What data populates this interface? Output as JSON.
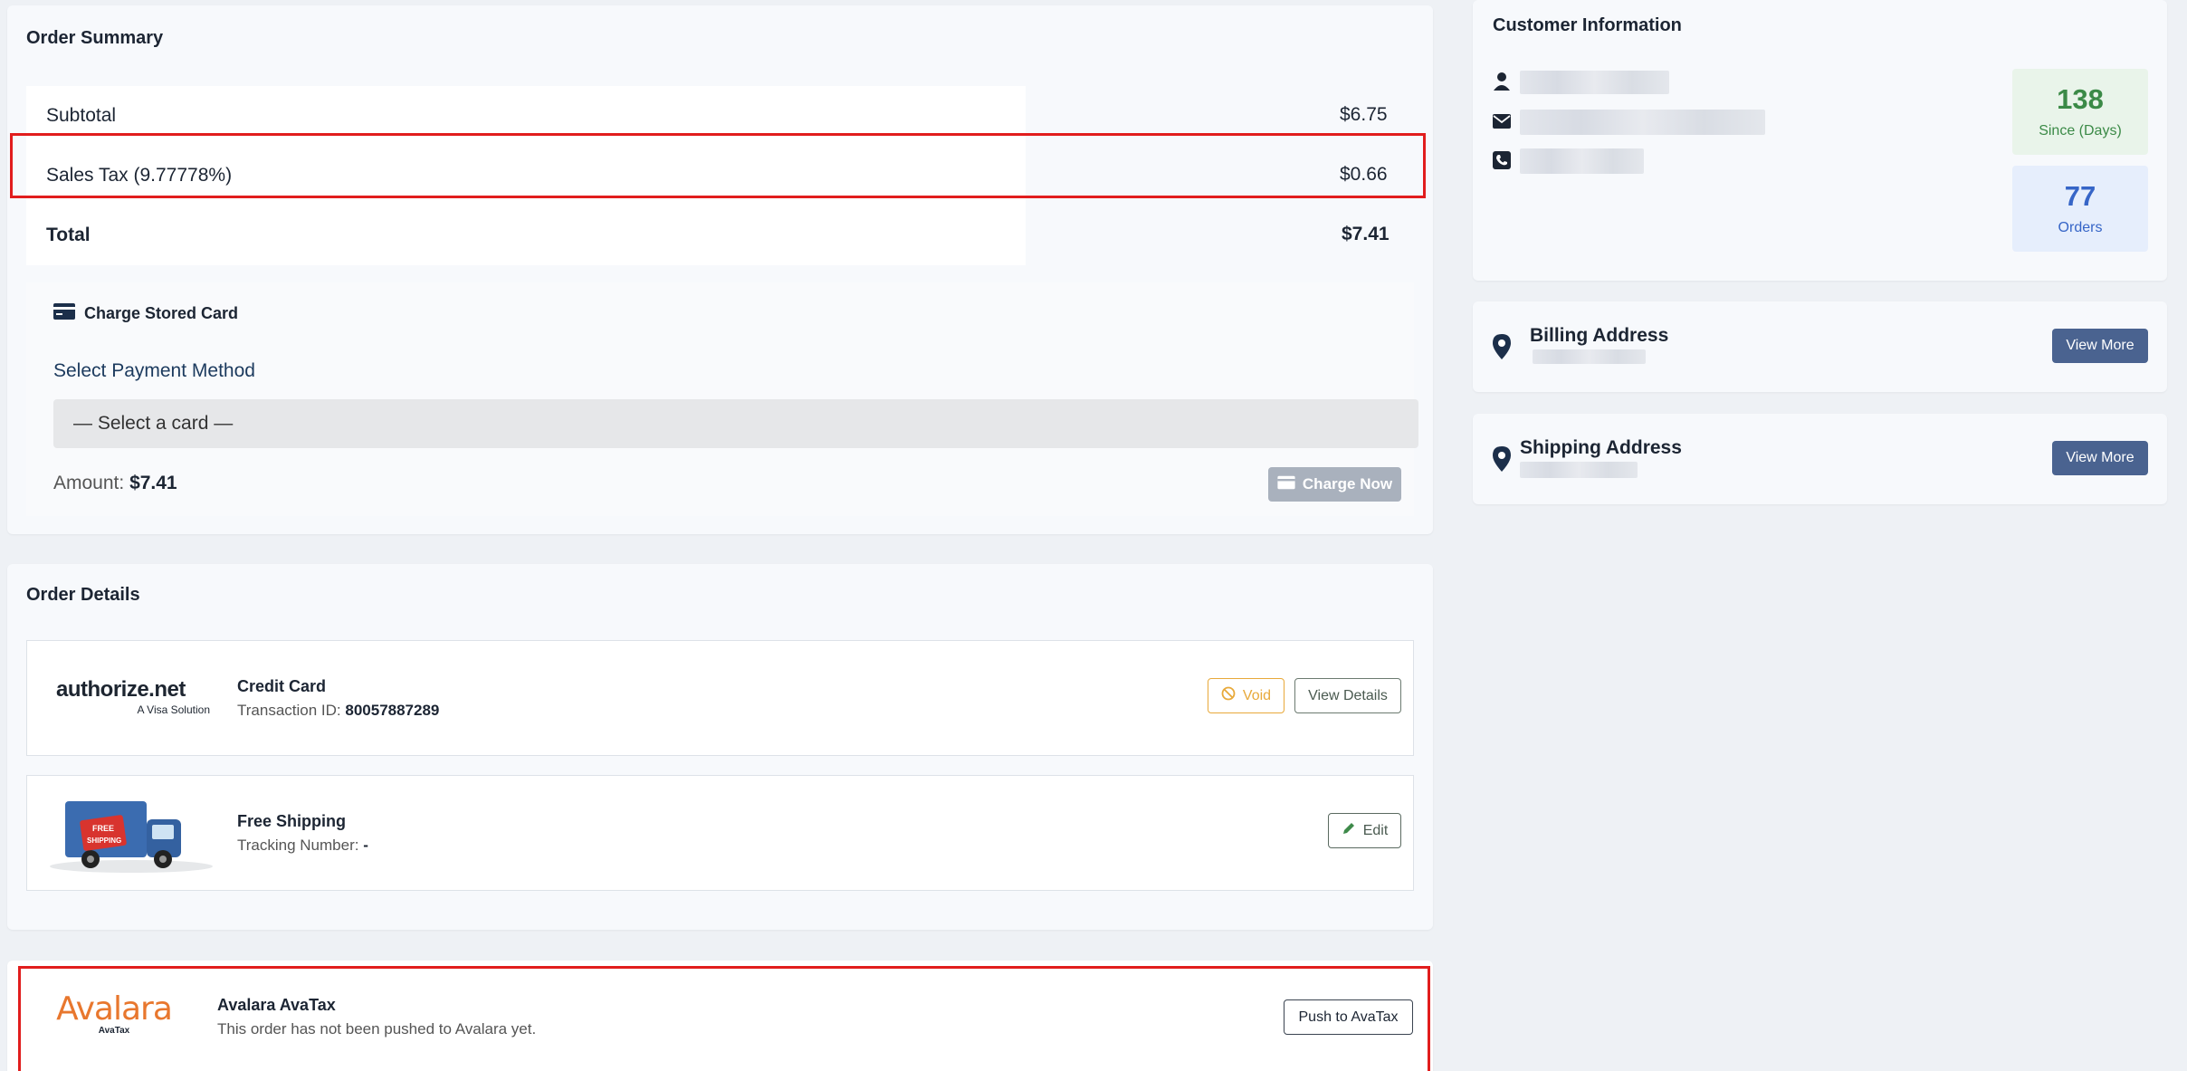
{
  "order_summary": {
    "title": "Order Summary",
    "subtotal_label": "Subtotal",
    "subtotal_value": "$6.75",
    "tax_label": "Sales Tax (9.77778%)",
    "tax_value": "$0.66",
    "total_label": "Total",
    "total_value": "$7.41",
    "charge_title": "Charge Stored Card",
    "select_label": "Select Payment Method",
    "select_value": "— Select a card —",
    "amount_label": "Amount:",
    "amount_value": "$7.41",
    "charge_button": "Charge Now"
  },
  "order_details": {
    "title": "Order Details",
    "payment": {
      "logo_text": "authorize.net",
      "logo_sub": "A Visa Solution",
      "title": "Credit Card",
      "txn_label": "Transaction ID:",
      "txn_value": "80057887289",
      "void_button": "Void",
      "details_button": "View Details"
    },
    "shipping": {
      "title": "Free Shipping",
      "tracking_label": "Tracking Number:",
      "tracking_value": "-",
      "edit_button": "Edit",
      "truck_text_1": "FREE",
      "truck_text_2": "SHIPPING"
    }
  },
  "avalara": {
    "logo_text": "Avalara",
    "logo_sub": "AvaTax",
    "title": "Avalara AvaTax",
    "status": "This order has not been pushed to Avalara yet.",
    "push_button": "Push to AvaTax"
  },
  "customer": {
    "title": "Customer Information",
    "since_days": "138",
    "since_label": "Since (Days)",
    "orders": "77",
    "orders_label": "Orders"
  },
  "billing": {
    "title": "Billing Address",
    "button": "View More"
  },
  "shipping_address": {
    "title": "Shipping Address",
    "button": "View More"
  },
  "colors": {
    "highlight": "#e11d1d",
    "view_more_bg": "#4a6390",
    "void": "#e8a93a",
    "days_green": "#3b8a47",
    "orders_blue": "#3665c7",
    "avalara_orange": "#e8772e"
  }
}
